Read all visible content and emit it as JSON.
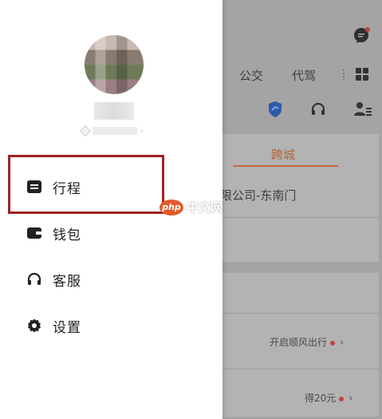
{
  "colors": {
    "accent_orange": "#c4693b",
    "highlight_red": "#9b2323",
    "notification_dot": "#c0443f",
    "shield_blue": "#2c6fd6"
  },
  "background": {
    "top_tabs": [
      "公交",
      "代驾"
    ],
    "active_tab": "跨城",
    "destination_text": "限公司-东南门",
    "shunfeng_text": "开启顺风出行",
    "reward_text": "得20元",
    "icons": [
      "chat-bubble-icon",
      "grid-icon",
      "shield-icon",
      "headset-icon",
      "user-list-icon"
    ]
  },
  "drawer": {
    "menu": [
      {
        "label": "行程",
        "icon": "trip-icon"
      },
      {
        "label": "钱包",
        "icon": "wallet-icon"
      },
      {
        "label": "客服",
        "icon": "headset-icon"
      },
      {
        "label": "设置",
        "icon": "gear-icon"
      }
    ]
  },
  "watermark": {
    "logo_text": "php",
    "site_text": "中文网"
  }
}
